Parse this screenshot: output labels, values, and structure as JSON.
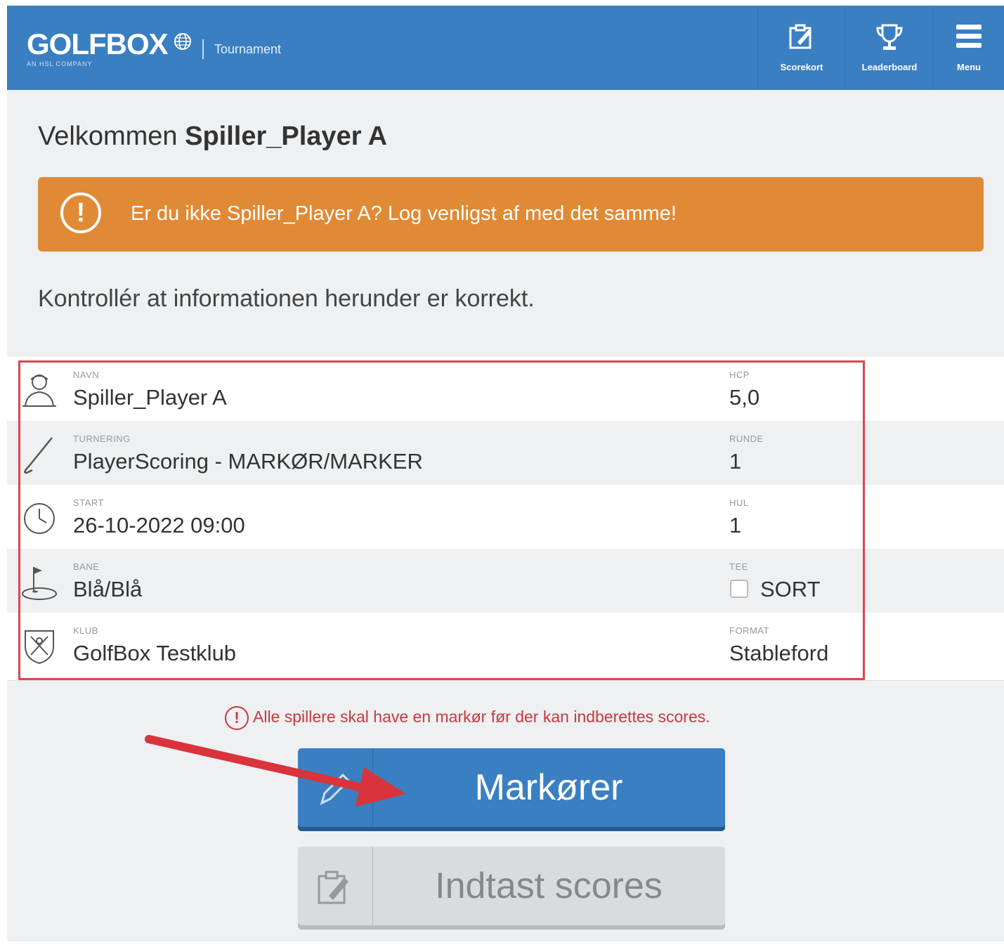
{
  "header": {
    "logo": "GOLFBOX",
    "logo_sub": "AN HSL COMPANY",
    "product": "Tournament",
    "buttons": [
      {
        "label": "Scorekort",
        "icon": "scorecard-icon"
      },
      {
        "label": "Leaderboard",
        "icon": "trophy-icon"
      },
      {
        "label": "Menu",
        "icon": "hamburger-menu-icon"
      }
    ]
  },
  "welcome": {
    "prefix": "Velkommen",
    "name": "Spiller_Player A"
  },
  "banner": {
    "message": "Er du ikke Spiller_Player A? Log venligst af med det samme!",
    "color": "#e08a35"
  },
  "check_text": "Kontrollér at informationen herunder er korrekt.",
  "info": [
    {
      "label": "NAVN",
      "value": "Spiller_Player A",
      "label2": "HCP",
      "value2": "5,0",
      "icon": "golfer-icon"
    },
    {
      "label": "TURNERING",
      "value": "PlayerScoring - MARKØR/MARKER",
      "label2": "RUNDE",
      "value2": "1",
      "icon": "golf-club-icon"
    },
    {
      "label": "START",
      "value": "26-10-2022 09:00",
      "label2": "HUL",
      "value2": "1",
      "icon": "clock-icon"
    },
    {
      "label": "BANE",
      "value": "Blå/Blå",
      "label2": "TEE",
      "value2": "SORT",
      "icon": "flag-green-icon"
    },
    {
      "label": "KLUB",
      "value": "GolfBox Testklub",
      "label2": "FORMAT",
      "value2": "Stableford",
      "icon": "club-crest-icon"
    }
  ],
  "notice": "Alle spillere skal have en markør før der kan indberettes scores.",
  "buttons": {
    "markers": "Markører",
    "enter_scores": "Indtast scores"
  },
  "colors": {
    "brand": "#3a7fc1",
    "warning": "#e08a35",
    "error": "#c63a3f",
    "highlight": "#d9474f"
  }
}
